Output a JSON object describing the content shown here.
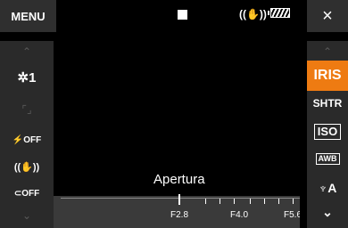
{
  "top_bar": {
    "menu_label": "MENU",
    "close_label": "×",
    "stabilizer_icon": "((✋))",
    "battery_icon": "battery-icon"
  },
  "left_panel": {
    "up_chevron": "⌃",
    "down_chevron": "⌄",
    "items": [
      {
        "name": "touch-decoration",
        "label": "✲1"
      },
      {
        "name": "face-detection",
        "label": "⌜⌟"
      },
      {
        "name": "flash-off",
        "label": "⚡OFF"
      },
      {
        "name": "stabilizer",
        "label": "((✋))"
      },
      {
        "name": "powered-is",
        "label": "⊂OFF"
      }
    ]
  },
  "right_panel": {
    "up_chevron": "⌃",
    "down_chevron": "⌄",
    "items": [
      {
        "name": "iris",
        "label": "IRIS",
        "active": true
      },
      {
        "name": "shutter",
        "label": "SHTR"
      },
      {
        "name": "iso",
        "label": "ISO"
      },
      {
        "name": "awb",
        "label": "AWB"
      },
      {
        "name": "mic",
        "label": "♆A"
      }
    ]
  },
  "slider": {
    "title": "Apertura",
    "current_value": "F2.8",
    "tick_labels": [
      "F2.8",
      "F4.0",
      "F5.6"
    ]
  },
  "colors": {
    "accent": "#ee7b12",
    "panel": "#2a2a2a",
    "slider_bg": "#3a3a3a"
  }
}
